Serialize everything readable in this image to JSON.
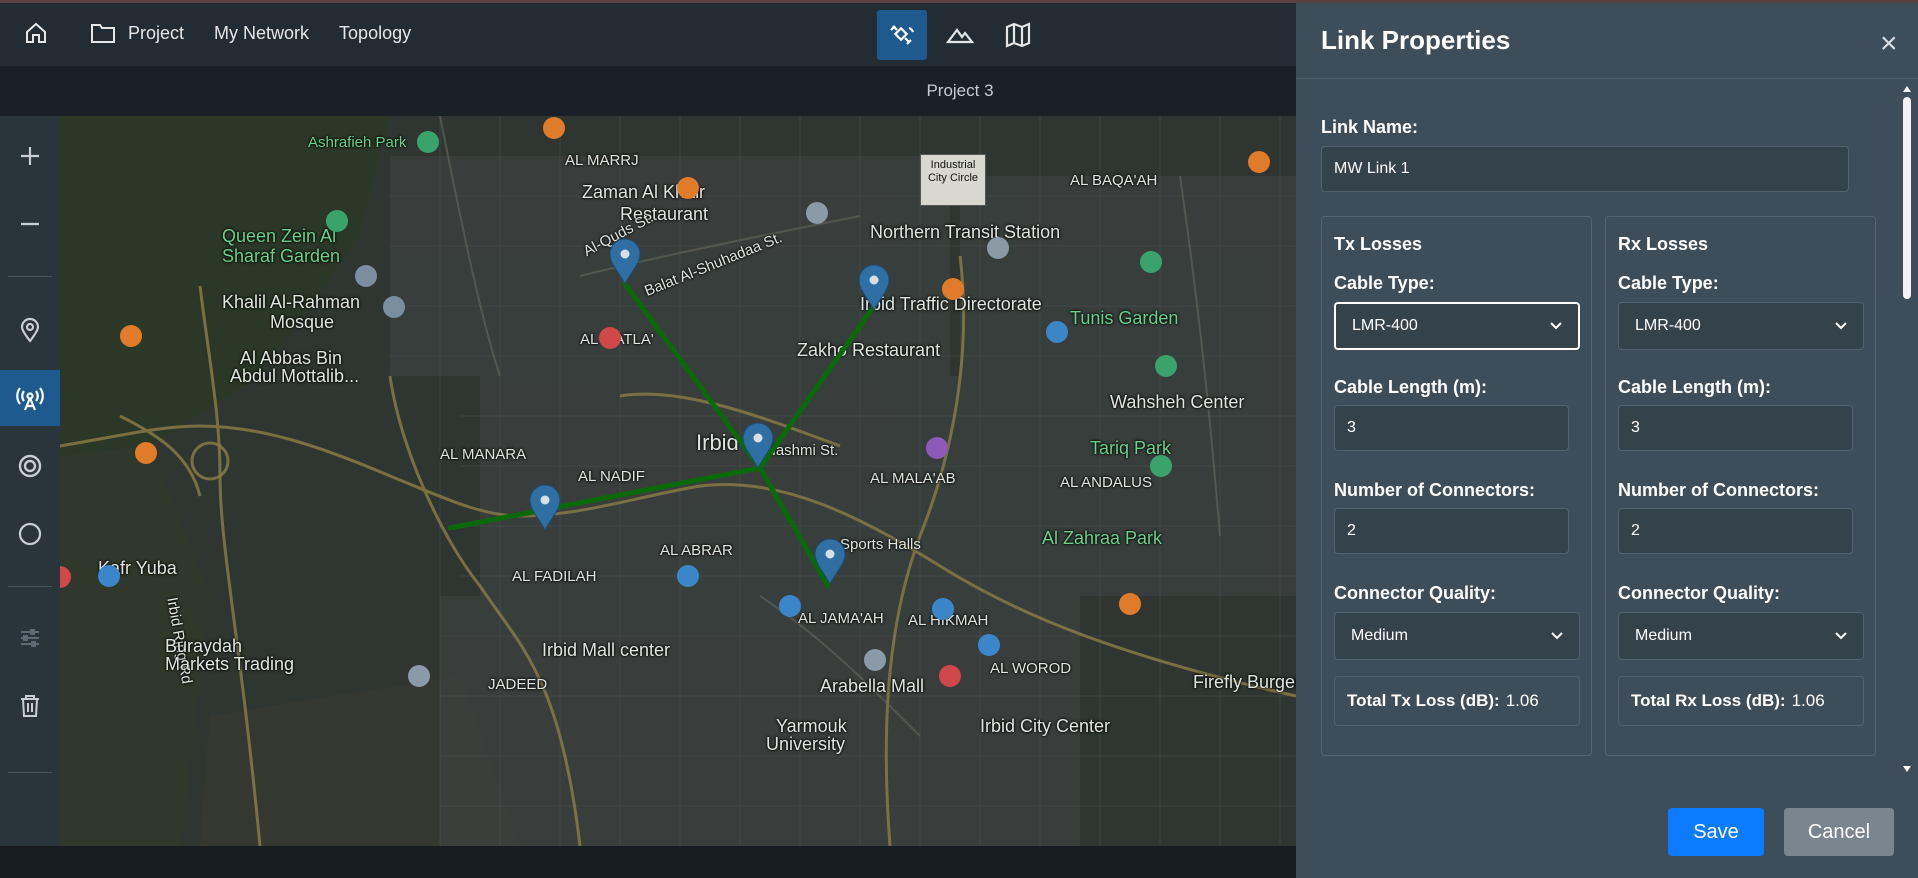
{
  "nav": {
    "home_icon": "home-icon",
    "project_label": "Project",
    "network_label": "My Network",
    "topology_label": "Topology"
  },
  "modes": [
    "satellite-dish-icon",
    "terrain-icon",
    "map-icon"
  ],
  "project_title": "Project 3",
  "tools": [
    "zoom-in-icon",
    "zoom-out-icon",
    "location-pin-icon",
    "antenna-icon",
    "target-icon",
    "circle-icon",
    "sliders-icon",
    "trash-icon"
  ],
  "map": {
    "labels": [
      "Ashrafieh Park",
      "AL MARRJ",
      "Zaman Al Khair",
      "Restaurant",
      "Queen Zein Al",
      "Sharaf Garden",
      "Khalil Al-Rahman",
      "Mosque",
      "Al Abbas Bin",
      "Abdul Mottalib...",
      "AL MATLA'",
      "Irbid Ring Rd",
      "Northern Transit Station",
      "Irbid Traffic Directorate",
      "Zakho Restaurant",
      "Tunis Garden",
      "Wahsheh Center",
      "Tariq Park",
      "AL ANDALUS",
      "AL BAQA'AH",
      "Industrial",
      "City Circle",
      "AL MANARA",
      "AL NADIF",
      "Irbid",
      "Hashmi St.",
      "AL MALA'AB",
      "AL ABRAR",
      "AL FADILAH",
      "Kafr Yuba",
      "Buraydah",
      "Markets Trading",
      "Irbid Mall center",
      "AL JAMA'AH",
      "AL HIKMAH",
      "Al Zahraa Park",
      "AL WOROD",
      "Firefly Burger Irbid",
      "Irbid City Center",
      "Arabella Mall",
      "Yarmouk",
      "University",
      "JADEED",
      "Sports Halls",
      "Al-Quds St.",
      "Balat Al-Shuhadaa St."
    ]
  },
  "panel": {
    "title": "Link Properties",
    "close": "×",
    "link_name_label": "Link Name:",
    "link_name_value": "MW Link 1",
    "tx": {
      "heading": "Tx Losses",
      "cable_type_label": "Cable Type:",
      "cable_type_value": "LMR-400",
      "cable_length_label": "Cable Length (m):",
      "cable_length_value": "3",
      "connectors_label": "Number of Connectors:",
      "connectors_value": "2",
      "quality_label": "Connector Quality:",
      "quality_value": "Medium",
      "total_label": "Total Tx Loss (dB):",
      "total_value": "1.06"
    },
    "rx": {
      "heading": "Rx Losses",
      "cable_type_label": "Cable Type:",
      "cable_type_value": "LMR-400",
      "cable_length_label": "Cable Length (m):",
      "cable_length_value": "3",
      "connectors_label": "Number of Connectors:",
      "connectors_value": "2",
      "quality_label": "Connector Quality:",
      "quality_value": "Medium",
      "total_label": "Total Rx Loss (dB):",
      "total_value": "1.06"
    },
    "save_label": "Save",
    "cancel_label": "Cancel"
  },
  "colors": {
    "accent": "#1f5a8f",
    "link_line": "#0a6a0a",
    "pin": "#2f6fa3",
    "save": "#0d7bff",
    "cancel": "#7b8590"
  }
}
